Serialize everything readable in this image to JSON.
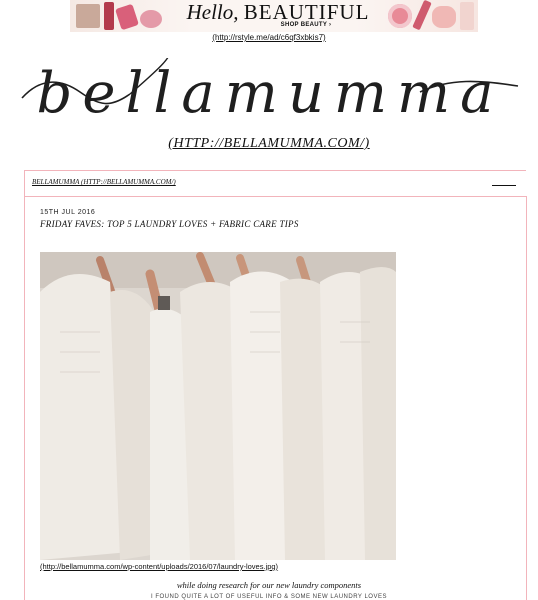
{
  "ad": {
    "headline_italic": "Hello,",
    "headline_caps": "BEAUTIFUL",
    "cta": "SHOP BEAUTY ›",
    "link": "(http://rstyle.me/ad/c6qf3xbkis7)"
  },
  "site": {
    "logo_text": "bellamumma",
    "link": "(HTTP://BELLAMUMMA.COM/)"
  },
  "nav": {
    "breadcrumb": "BELLAMUMMA (HTTP://BELLAMUMMA.COM/)",
    "menu_icon": "hamburger-icon"
  },
  "post": {
    "date": "15TH JUL 2016",
    "title": "FRIDAY FAVES: TOP 5 LAUNDRY LOVES + FABRIC CARE TIPS",
    "image_caption": "(http://bellamumma.com/wp-content/uploads/2016/07/laundry-loves.jpg)",
    "intro": "while doing research for our new laundry components",
    "cutoff": "I FOUND QUITE A LOT OF USEFUL INFO & SOME NEW LAUNDRY LOVES"
  },
  "colors": {
    "accent_rule": "#f2b4bb",
    "text": "#111111"
  }
}
